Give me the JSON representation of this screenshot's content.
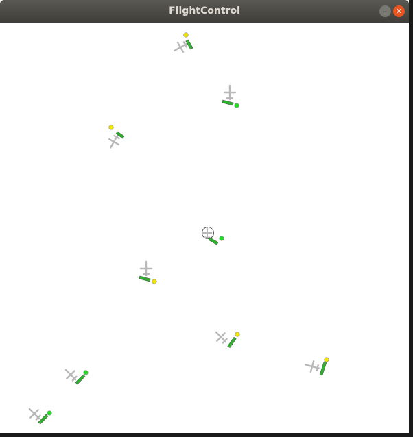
{
  "window": {
    "title": "FlightControl",
    "minimize_glyph": "–",
    "close_glyph": "✕"
  },
  "colors": {
    "titlebar": "#4a4945",
    "close": "#e9541f",
    "plane": "#b8b8b8",
    "bar_green": "#2ab52a",
    "dot_yellow": "#f2e600",
    "dot_green": "#22dd22"
  },
  "aircraft": [
    {
      "id": "plane-1",
      "dot": "yellow",
      "selected": false
    },
    {
      "id": "plane-2",
      "dot": "green",
      "selected": false
    },
    {
      "id": "plane-3",
      "dot": "yellow",
      "selected": false
    },
    {
      "id": "plane-4",
      "dot": "green",
      "selected": true
    },
    {
      "id": "plane-5",
      "dot": "yellow",
      "selected": false
    },
    {
      "id": "plane-6",
      "dot": "yellow",
      "selected": false
    },
    {
      "id": "plane-7",
      "dot": "yellow",
      "selected": false
    },
    {
      "id": "plane-8",
      "dot": "green",
      "selected": false
    },
    {
      "id": "plane-9",
      "dot": "green",
      "selected": false
    }
  ]
}
